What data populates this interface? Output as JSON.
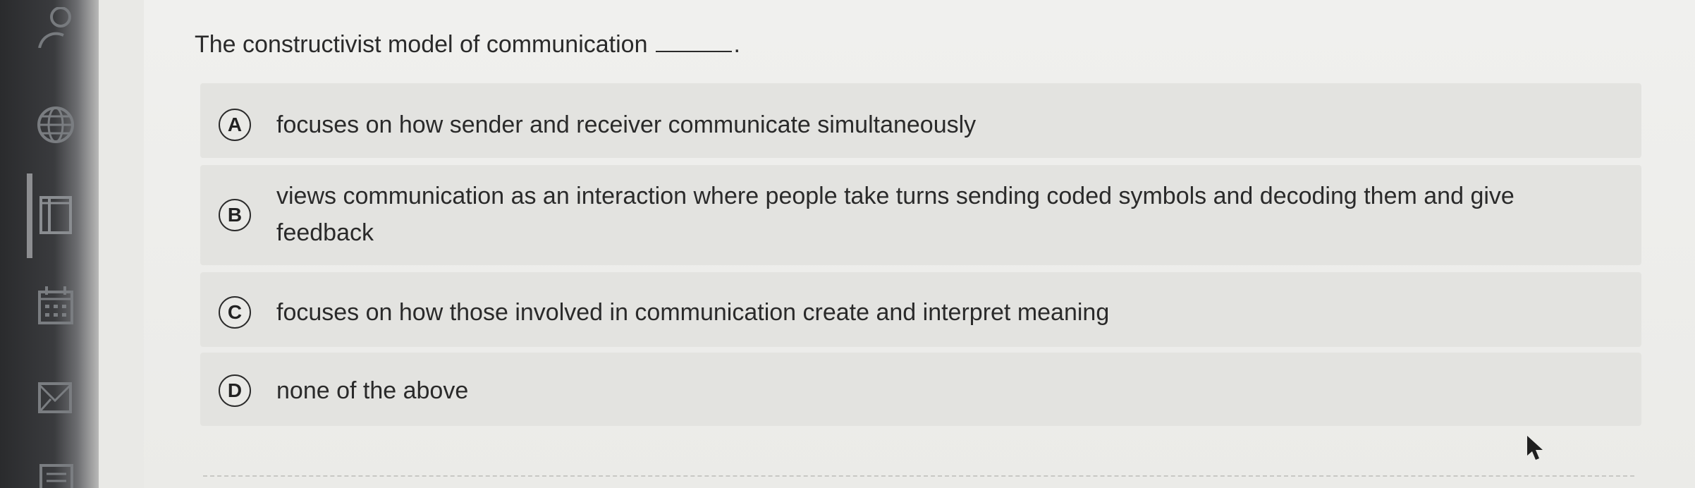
{
  "question": {
    "text": "The constructivist model of communication",
    "end_punct": "."
  },
  "options": [
    {
      "letter": "A",
      "text": "focuses on how sender and receiver communicate simultaneously"
    },
    {
      "letter": "B",
      "text": "views communication as an interaction where people take turns sending coded symbols and decoding them and give feedback"
    },
    {
      "letter": "C",
      "text": "focuses on how those involved in communication create and interpret meaning"
    },
    {
      "letter": "D",
      "text": "none of the above"
    }
  ],
  "sidebar": {
    "icons": [
      "user-icon",
      "globe-icon",
      "courses-icon",
      "calendar-icon",
      "inbox-icon",
      "history-icon"
    ]
  },
  "colors": {
    "rail": "#2a2b2d",
    "content_bg": "#ebebe8",
    "option_bg": "#e3e3e0",
    "text": "#2a2a2a"
  }
}
